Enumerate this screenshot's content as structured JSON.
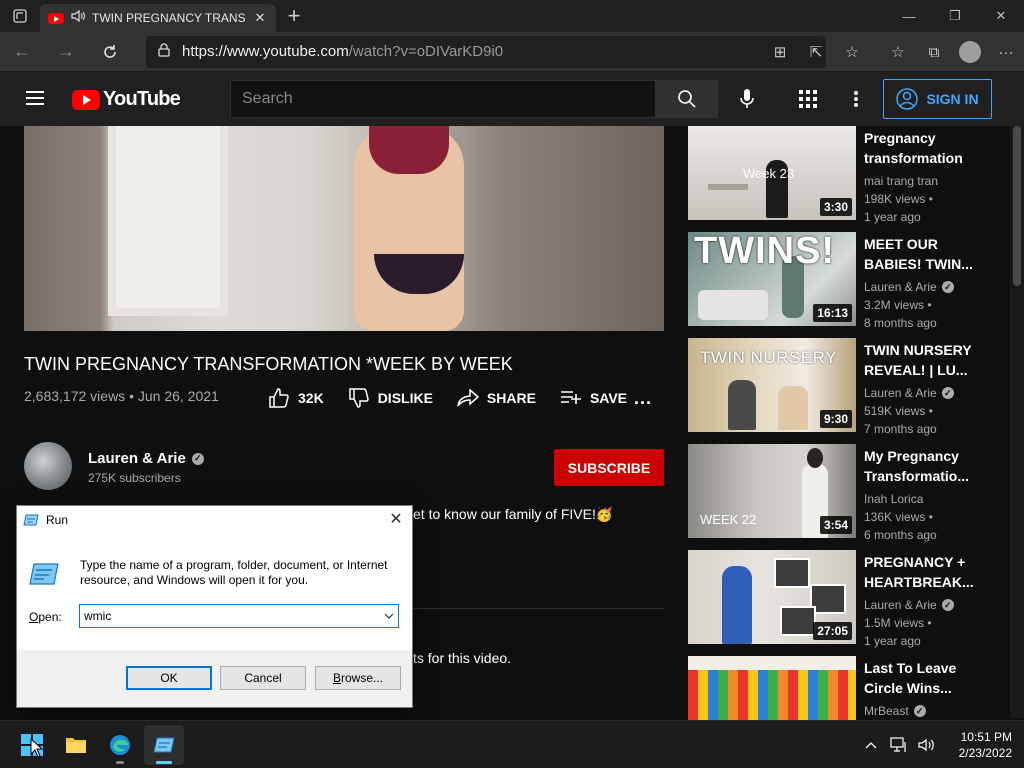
{
  "browser": {
    "tab_title": "TWIN PREGNANCY TRANSF",
    "url_host": "https://www.youtube.com",
    "url_path": "/watch?v=oDIVarKD9i0"
  },
  "youtube": {
    "logo_text": "YouTube",
    "search_placeholder": "Search",
    "signin_label": "SIGN IN"
  },
  "video": {
    "title": "TWIN PREGNANCY TRANSFORMATION *WEEK BY WEEK",
    "views_date": "2,683,172 views • Jun 26, 2021",
    "like_count": "32K",
    "dislike_label": "DISLIKE",
    "share_label": "SHARE",
    "save_label": "SAVE",
    "more_label": "...",
    "channel_name": "Lauren & Arie",
    "subscribers": "275K subscribers",
    "subscribe_label": "SUBSCRIBE",
    "description_fragment": "et to know our family of FIVE!🥳",
    "comments_fragment": "ts for this video."
  },
  "recommendations": [
    {
      "title": "Pregnancy transformation",
      "channel": "mai trang tran",
      "verified": false,
      "views": "198K views •",
      "age": "1 year ago",
      "duration": "3:30",
      "overlay": "Week 23"
    },
    {
      "title": "MEET OUR BABIES! TWIN...",
      "channel": "Lauren & Arie",
      "verified": true,
      "views": "3.2M views •",
      "age": "8 months ago",
      "duration": "16:13",
      "overlay": "TWINS!"
    },
    {
      "title": "TWIN NURSERY REVEAL! | LU...",
      "channel": "Lauren & Arie",
      "verified": true,
      "views": "519K views •",
      "age": "7 months ago",
      "duration": "9:30",
      "overlay": "TWIN NURSERY"
    },
    {
      "title": "My Pregnancy Transformatio...",
      "channel": "Inah Lorica",
      "verified": false,
      "views": "136K views •",
      "age": "6 months ago",
      "duration": "3:54",
      "overlay": "WEEK 22"
    },
    {
      "title": "PREGNANCY + HEARTBREAK...",
      "channel": "Lauren & Arie",
      "verified": true,
      "views": "1.5M views •",
      "age": "1 year ago",
      "duration": "27:05",
      "overlay": ""
    },
    {
      "title": "Last To Leave Circle Wins...",
      "channel": "MrBeast",
      "verified": true,
      "views": "",
      "age": "",
      "duration": "",
      "overlay": ""
    }
  ],
  "run_dialog": {
    "title": "Run",
    "message": "Type the name of a program, folder, document, or Internet resource, and Windows will open it for you.",
    "open_label_underlined": "O",
    "open_label_rest": "pen:",
    "input_value": "wmic",
    "ok_label": "OK",
    "cancel_label": "Cancel",
    "browse_underlined": "B",
    "browse_rest": "rowse..."
  },
  "taskbar": {
    "time": "10:51 PM",
    "date": "2/23/2022"
  },
  "colors": {
    "yt_red": "#ff0000",
    "subscribe_red": "#cc0000",
    "signin_blue": "#3ea6ff",
    "win_accent": "#0078d7"
  }
}
